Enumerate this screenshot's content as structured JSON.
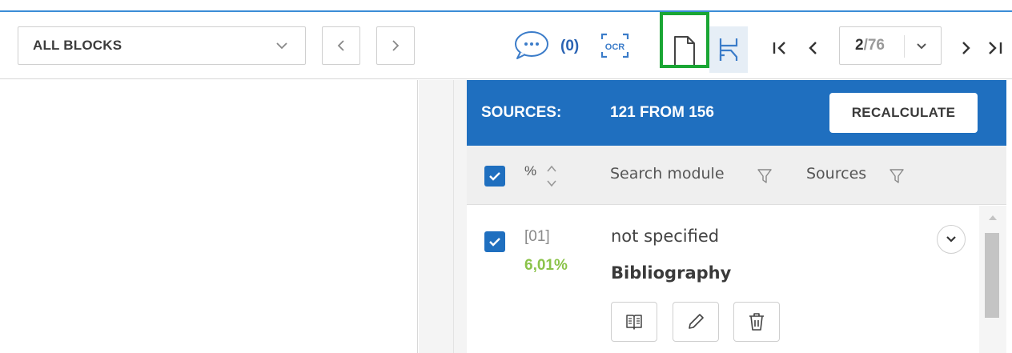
{
  "toolbar": {
    "block_filter": {
      "selected": "ALL BLOCKS"
    },
    "comments": {
      "count_label": "(0)"
    },
    "ocr_label": "OCR",
    "pagination": {
      "current": "2",
      "total": "/76"
    }
  },
  "sources_panel": {
    "title": "SOURCES:",
    "count_label": "121 FROM 156",
    "recalculate_label": "RECALCULATE",
    "columns": {
      "percent": "%",
      "search_module": "Search module",
      "sources": "Sources"
    },
    "rows": [
      {
        "index": "[01]",
        "percent": "6,01%",
        "source_name": "not specified",
        "module": "Bibliography",
        "checked": true
      }
    ]
  },
  "colors": {
    "accent": "#1f6fbf",
    "highlight": "#1aa634",
    "percent_green": "#8bc34a"
  },
  "icons": [
    "chevron-down-icon",
    "chevron-left-icon",
    "chevron-right-icon",
    "comment-icon",
    "ocr-icon",
    "document-icon",
    "split-view-icon",
    "first-page-icon",
    "prev-page-icon",
    "next-page-icon",
    "last-page-icon",
    "checkbox-icon",
    "sort-icon",
    "filter-icon",
    "expand-icon",
    "book-icon",
    "pencil-icon",
    "trash-icon"
  ]
}
